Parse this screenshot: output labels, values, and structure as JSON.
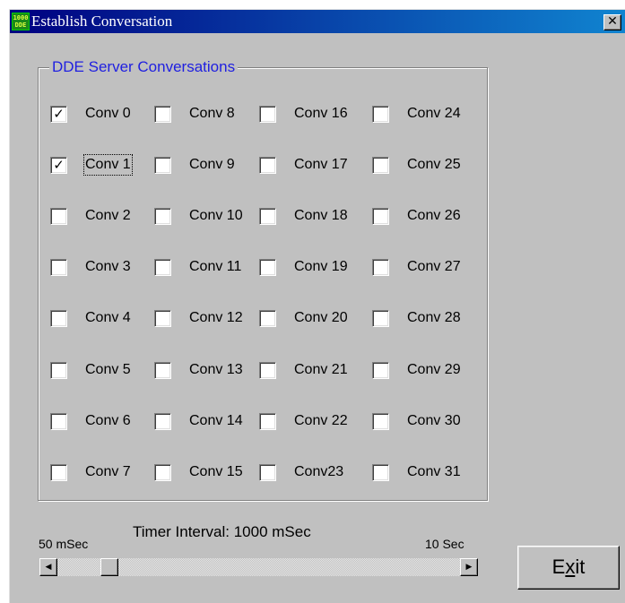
{
  "window": {
    "title": "Establish Conversation",
    "app_icon_text": [
      "1000",
      "DDE"
    ],
    "close_glyph": "✕"
  },
  "group": {
    "legend": "DDE Server Conversations",
    "columns": [
      [
        {
          "label": "Conv 0",
          "checked": true
        },
        {
          "label": "Conv 1",
          "checked": true,
          "focused": true
        },
        {
          "label": "Conv 2",
          "checked": false
        },
        {
          "label": "Conv 3",
          "checked": false
        },
        {
          "label": "Conv 4",
          "checked": false
        },
        {
          "label": "Conv 5",
          "checked": false
        },
        {
          "label": "Conv 6",
          "checked": false
        },
        {
          "label": "Conv 7",
          "checked": false
        }
      ],
      [
        {
          "label": "Conv 8",
          "checked": false
        },
        {
          "label": "Conv 9",
          "checked": false
        },
        {
          "label": "Conv 10",
          "checked": false
        },
        {
          "label": "Conv 11",
          "checked": false
        },
        {
          "label": "Conv 12",
          "checked": false
        },
        {
          "label": "Conv 13",
          "checked": false
        },
        {
          "label": "Conv 14",
          "checked": false
        },
        {
          "label": "Conv 15",
          "checked": false
        }
      ],
      [
        {
          "label": "Conv 16",
          "checked": false
        },
        {
          "label": "Conv 17",
          "checked": false
        },
        {
          "label": "Conv 18",
          "checked": false
        },
        {
          "label": "Conv 19",
          "checked": false
        },
        {
          "label": "Conv 20",
          "checked": false
        },
        {
          "label": "Conv 21",
          "checked": false
        },
        {
          "label": "Conv 22",
          "checked": false
        },
        {
          "label": "Conv23",
          "checked": false
        }
      ],
      [
        {
          "label": "Conv 24",
          "checked": false
        },
        {
          "label": "Conv 25",
          "checked": false
        },
        {
          "label": "Conv 26",
          "checked": false
        },
        {
          "label": "Conv 27",
          "checked": false
        },
        {
          "label": "Conv 28",
          "checked": false
        },
        {
          "label": "Conv 29",
          "checked": false
        },
        {
          "label": "Conv 30",
          "checked": false
        },
        {
          "label": "Conv 31",
          "checked": false
        }
      ]
    ]
  },
  "timer": {
    "label": "Timer Interval: 1000 mSec",
    "min_label": "50 mSec",
    "max_label": "10 Sec",
    "left_arrow": "◀",
    "right_arrow": "▶"
  },
  "exit_button": {
    "label_pre": "E",
    "label_underlined": "x",
    "label_post": "it"
  },
  "colors": {
    "title_start": "#000080",
    "title_end": "#1084d0",
    "face": "#c0c0c0",
    "legend_text": "#2020e0"
  }
}
